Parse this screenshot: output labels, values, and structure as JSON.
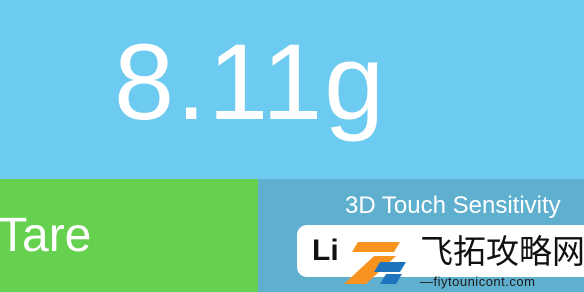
{
  "display": {
    "reading": "8.11g"
  },
  "tare": {
    "label": "Tare"
  },
  "sensitivity": {
    "title": "3D Touch Sensitivity",
    "selected_option_partial": "Li"
  },
  "watermark": {
    "text": "飞拓攻略网",
    "url": "—fiytounicont.com",
    "colors": {
      "orange": "#f7931e",
      "blue": "#1e73be"
    }
  },
  "colors": {
    "display_bg": "#6dcaf0",
    "tare_bg": "#66d04f",
    "panel_bg": "#5fb0cf"
  }
}
